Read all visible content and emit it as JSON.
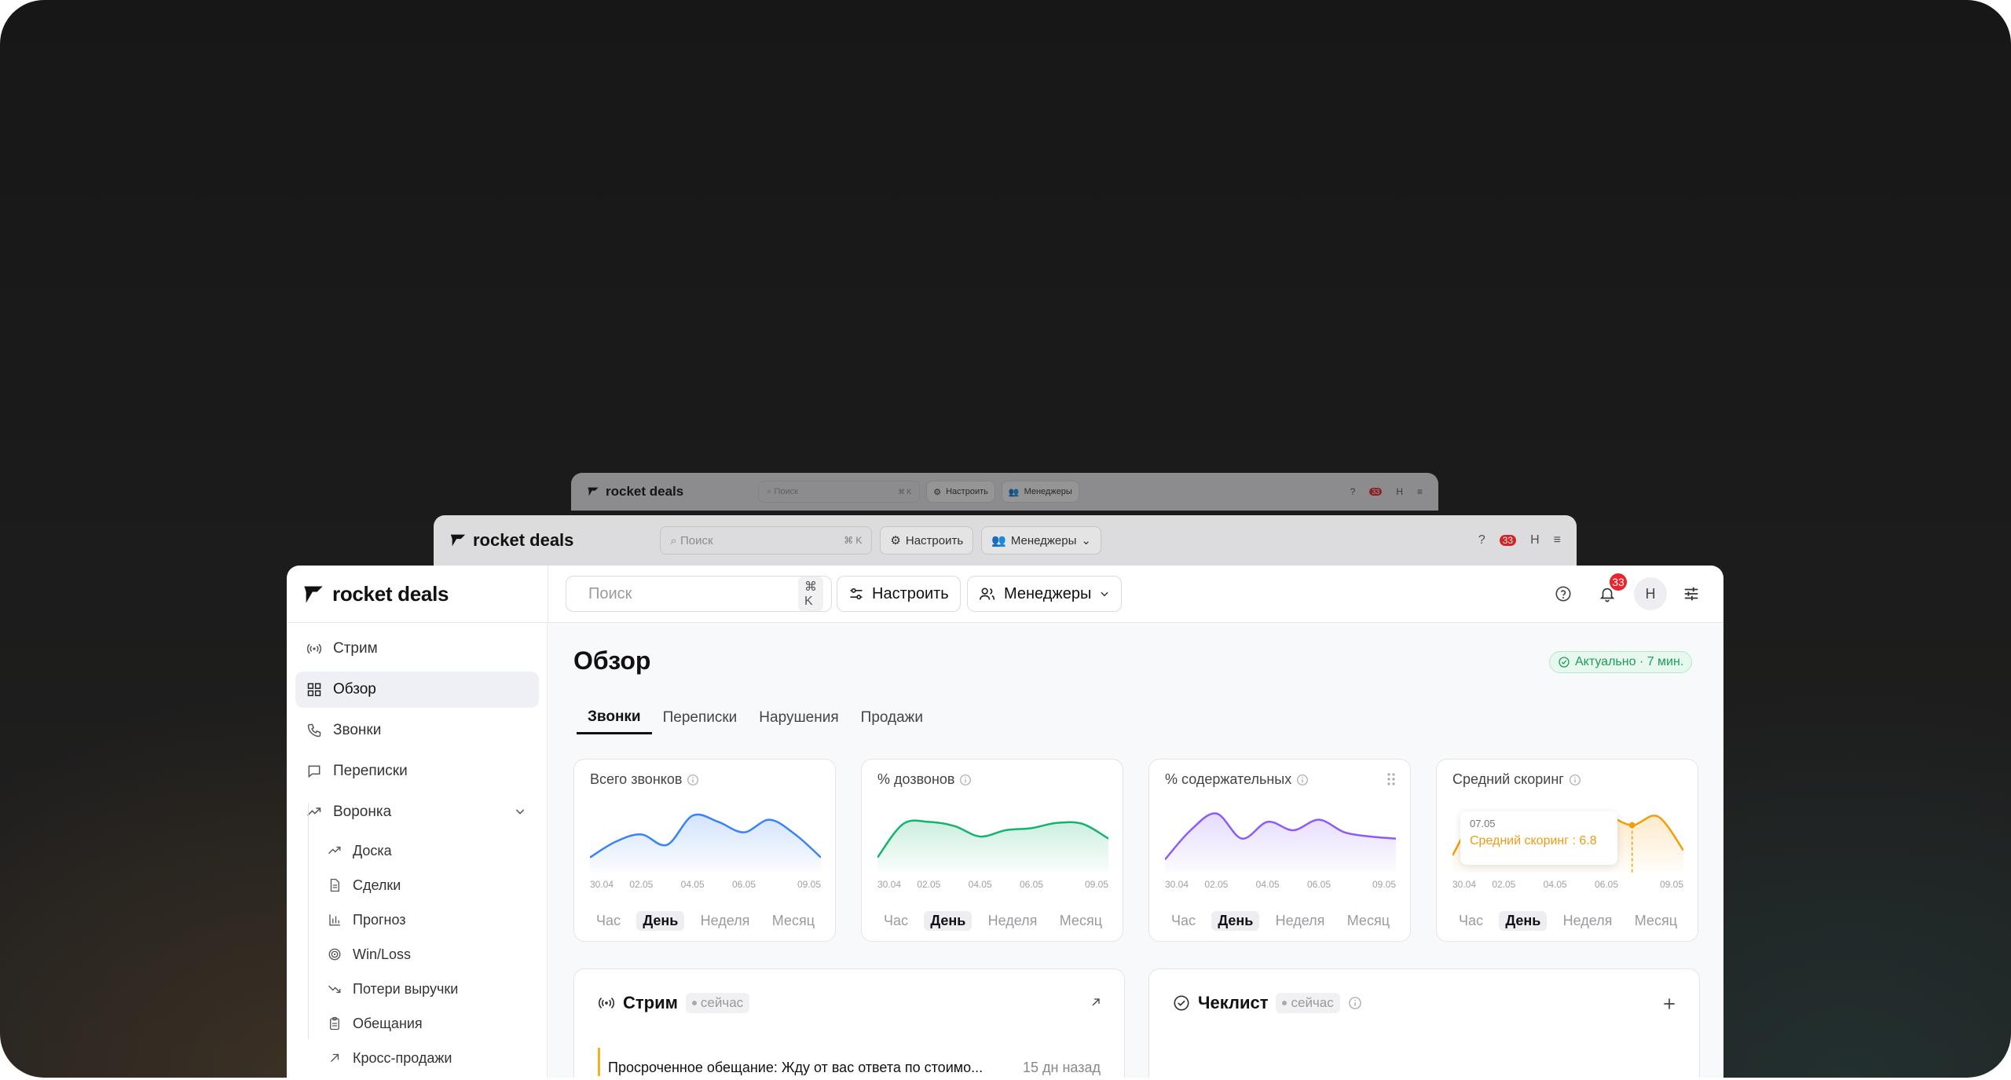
{
  "brand": {
    "name": "rocket deals"
  },
  "ghost_top": {
    "search_placeholder": "Поиск",
    "kbd": "⌘ K",
    "configure": "Настроить",
    "managers": "Менеджеры",
    "badge": "33",
    "avatar": "Н"
  },
  "ghost_mid": {
    "search_placeholder": "Поиск",
    "kbd": "⌘ K",
    "configure": "Настроить",
    "managers": "Менеджеры",
    "badge": "33",
    "avatar": "Н"
  },
  "topbar": {
    "search_placeholder": "Поиск",
    "search_kbd": "⌘ K",
    "configure_label": "Настроить",
    "managers_label": "Менеджеры",
    "notifications_count": "33",
    "avatar_initial": "Н"
  },
  "sidebar": {
    "items": [
      {
        "label": "Стрим",
        "icon": "broadcast-icon"
      },
      {
        "label": "Обзор",
        "icon": "dashboard-icon",
        "active": true
      },
      {
        "label": "Звонки",
        "icon": "phone-icon"
      },
      {
        "label": "Переписки",
        "icon": "chat-icon"
      },
      {
        "label": "Воронка",
        "icon": "trend-icon",
        "expanded": true
      }
    ],
    "subitems": [
      {
        "label": "Доска",
        "icon": "trend-up-icon"
      },
      {
        "label": "Сделки",
        "icon": "document-icon"
      },
      {
        "label": "Прогноз",
        "icon": "bar-chart-icon"
      },
      {
        "label": "Win/Loss",
        "icon": "target-icon"
      },
      {
        "label": "Потери выручки",
        "icon": "trend-down-icon"
      },
      {
        "label": "Обещания",
        "icon": "clipboard-icon"
      },
      {
        "label": "Кросс-продажи",
        "icon": "arrow-up-right-icon"
      }
    ]
  },
  "main": {
    "title": "Обзор",
    "status": "Актуально · 7 мин.",
    "tabs": [
      "Звонки",
      "Переписки",
      "Нарушения",
      "Продажи"
    ],
    "periods": [
      "Час",
      "День",
      "Неделя",
      "Месяц"
    ],
    "active_period": "День"
  },
  "chart_data": [
    {
      "type": "area",
      "title": "Всего звонков",
      "color": "#3b82f6",
      "x": [
        "30.04",
        "01.05",
        "02.05",
        "03.05",
        "04.05",
        "05.05",
        "06.05",
        "07.05",
        "08.05",
        "09.05"
      ],
      "x_ticks": [
        "30.04",
        "02.05",
        "04.05",
        "06.05",
        "09.05"
      ],
      "values": [
        10,
        25,
        32,
        22,
        50,
        44,
        34,
        46,
        32,
        10
      ],
      "ylim": [
        0,
        60
      ]
    },
    {
      "type": "area",
      "title": "% дозвонов",
      "color": "#16b36e",
      "x": [
        "30.04",
        "01.05",
        "02.05",
        "03.05",
        "04.05",
        "05.05",
        "06.05",
        "07.05",
        "08.05",
        "09.05"
      ],
      "x_ticks": [
        "30.04",
        "02.05",
        "04.05",
        "06.05",
        "09.05"
      ],
      "values": [
        10,
        42,
        44,
        40,
        30,
        36,
        38,
        43,
        42,
        28
      ],
      "ylim": [
        0,
        60
      ]
    },
    {
      "type": "area",
      "title": "% содержательных",
      "color": "#8b5cf6",
      "x": [
        "30.04",
        "01.05",
        "02.05",
        "03.05",
        "04.05",
        "05.05",
        "06.05",
        "07.05",
        "08.05",
        "09.05"
      ],
      "x_ticks": [
        "30.04",
        "02.05",
        "04.05",
        "06.05",
        "09.05"
      ],
      "values": [
        8,
        36,
        52,
        28,
        44,
        36,
        46,
        34,
        30,
        28
      ],
      "ylim": [
        0,
        60
      ]
    },
    {
      "type": "area",
      "title": "Средний скоринг",
      "color": "#f59e0b",
      "x": [
        "30.04",
        "01.05",
        "02.05",
        "03.05",
        "04.05",
        "05.05",
        "06.05",
        "07.05",
        "08.05",
        "09.05"
      ],
      "x_ticks": [
        "30.04",
        "02.05",
        "04.05",
        "06.05",
        "09.05"
      ],
      "values": [
        2,
        8.5,
        6.8,
        8.6,
        8.4,
        8.6,
        8.4,
        6.8,
        8.2,
        2.8
      ],
      "ylim": [
        0,
        10
      ],
      "tooltip": {
        "date": "07.05",
        "label": "Средний скоринг : 6.8"
      }
    }
  ],
  "stream_card": {
    "title": "Стрим",
    "badge": "сейчас",
    "item_text": "Просроченное обещание: Жду от вас ответа по стоимо...",
    "item_time": "15 дн назад"
  },
  "checklist_card": {
    "title": "Чеклист",
    "badge": "сейчас"
  }
}
